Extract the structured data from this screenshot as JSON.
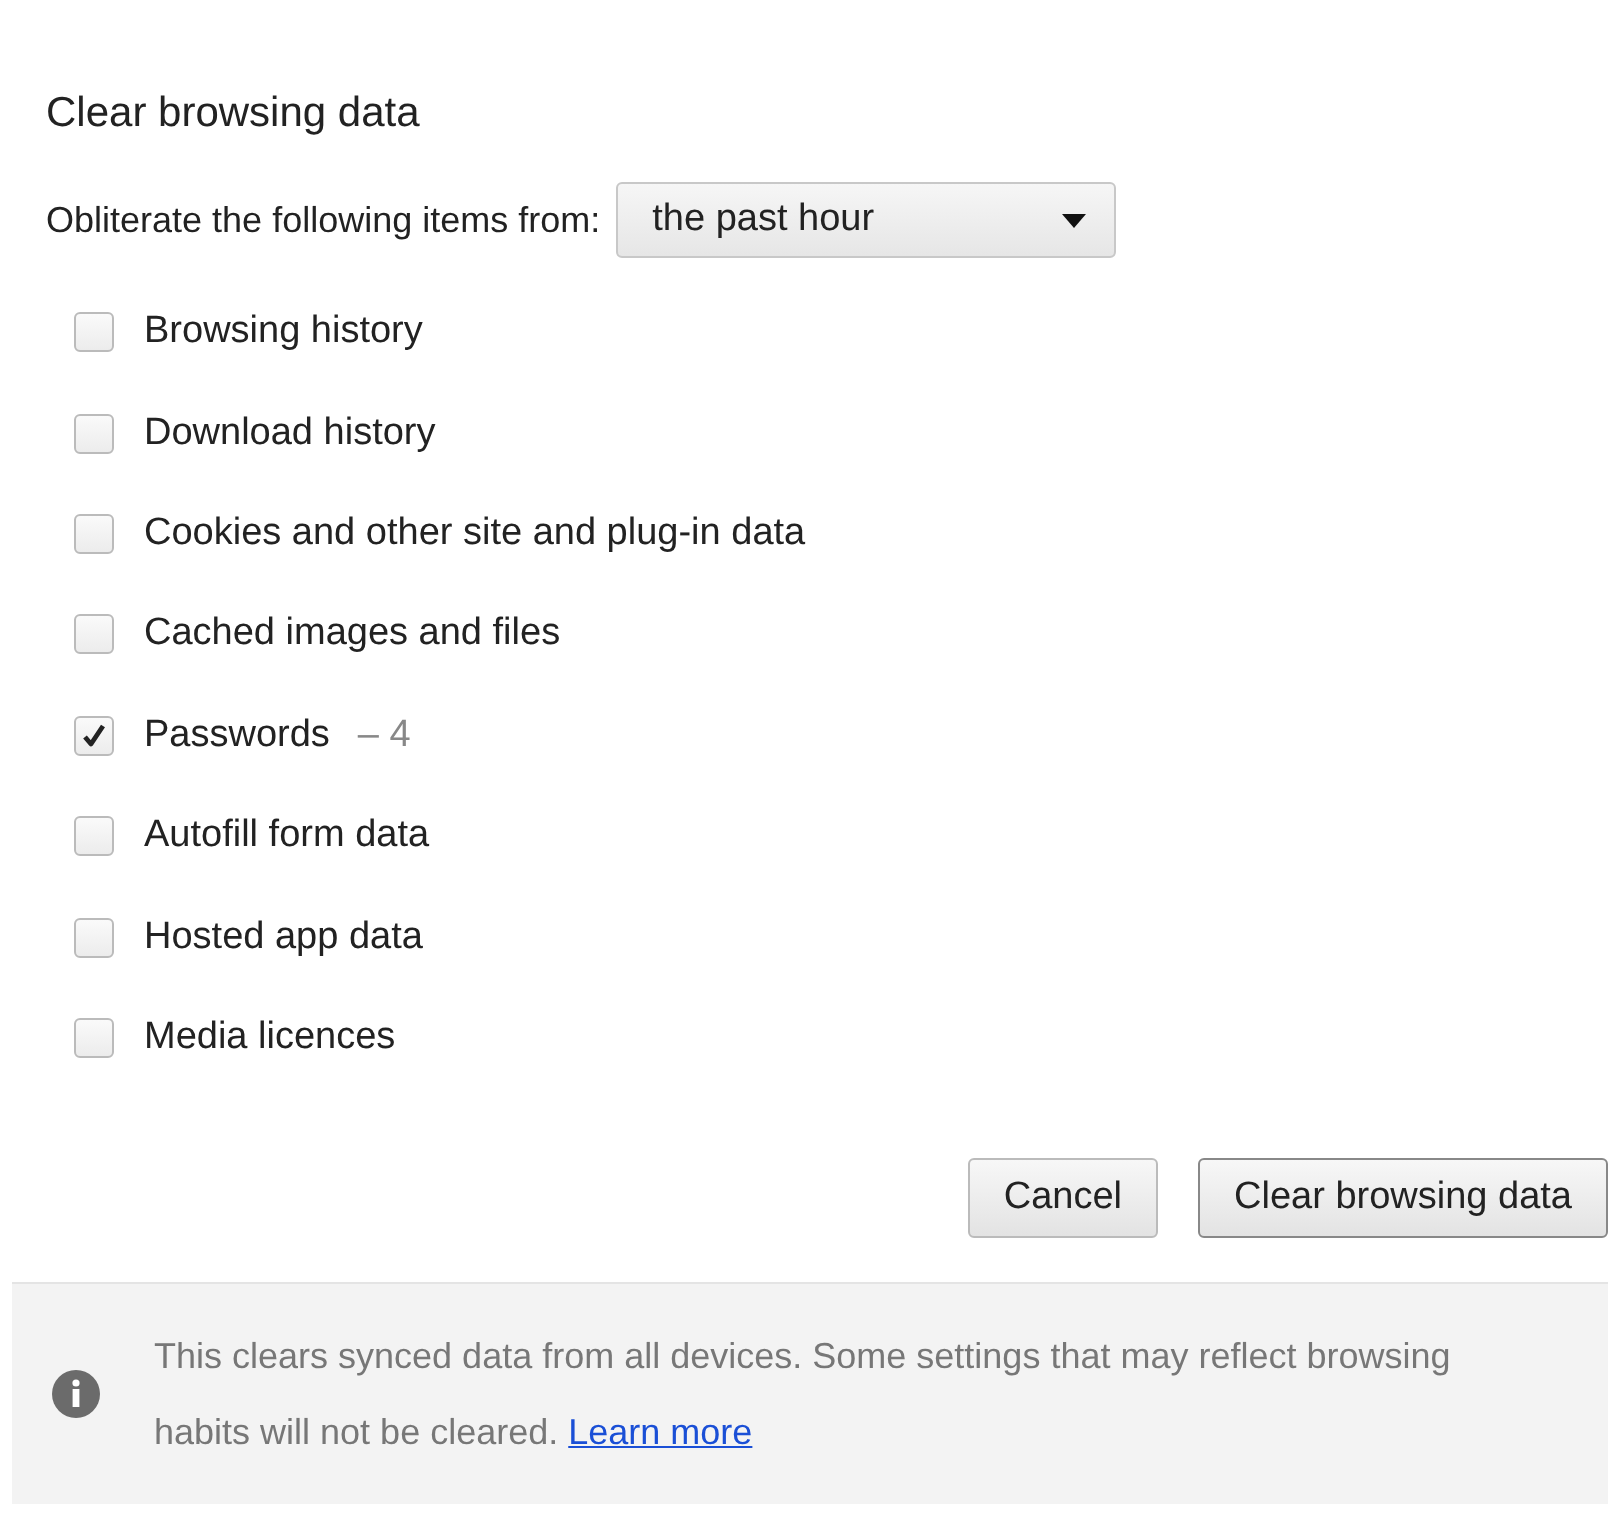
{
  "dialog": {
    "title": "Clear browsing data"
  },
  "period": {
    "label": "Obliterate the following items from:",
    "value": "the past hour"
  },
  "items": [
    {
      "label": "Browsing history",
      "checked": false
    },
    {
      "label": "Download history",
      "checked": false
    },
    {
      "label": "Cookies and other site and plug-in data",
      "checked": false
    },
    {
      "label": "Cached images and files",
      "checked": false
    },
    {
      "label": "Passwords",
      "checked": true,
      "count": "– 4"
    },
    {
      "label": "Autofill form data",
      "checked": false
    },
    {
      "label": "Hosted app data",
      "checked": false
    },
    {
      "label": "Media licences",
      "checked": false
    }
  ],
  "buttons": [
    {
      "label": "Cancel",
      "kind": "secondary"
    },
    {
      "label": "Clear browsing data",
      "kind": "primary"
    }
  ],
  "footer": {
    "text": "This clears synced data from all devices. Some settings that may reflect browsing habits will not be cleared.",
    "link": "Learn more"
  }
}
